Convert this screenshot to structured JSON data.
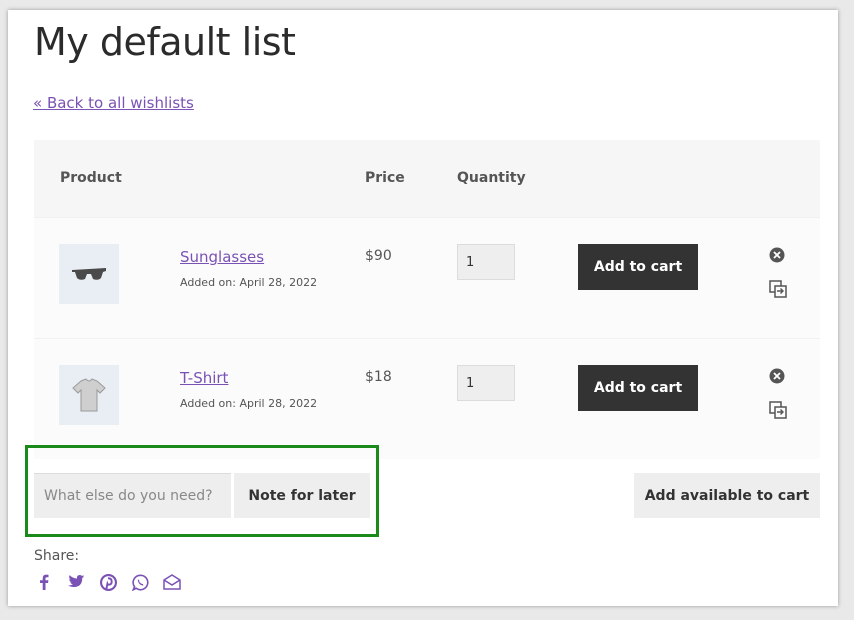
{
  "page": {
    "title": "My default list",
    "back_link": "« Back to all wishlists"
  },
  "table": {
    "headers": {
      "product": "Product",
      "price": "Price",
      "quantity": "Quantity"
    },
    "rows": [
      {
        "name": "Sunglasses",
        "added": "Added on: April 28, 2022",
        "price": "$90",
        "quantity": "1",
        "button": "Add to cart",
        "thumb_icon": "sunglasses-icon"
      },
      {
        "name": "T-Shirt",
        "added": "Added on: April 28, 2022",
        "price": "$18",
        "quantity": "1",
        "button": "Add to cart",
        "thumb_icon": "tshirt-icon"
      }
    ]
  },
  "note": {
    "placeholder": "What else do you need?",
    "button": "Note for later"
  },
  "add_all": "Add available to cart",
  "share": {
    "label": "Share:",
    "icons": [
      "facebook-icon",
      "twitter-icon",
      "pinterest-icon",
      "whatsapp-icon",
      "email-icon"
    ]
  },
  "colors": {
    "link": "#7a52b5",
    "button_dark": "#333333",
    "highlight": "#1a8a1a"
  }
}
